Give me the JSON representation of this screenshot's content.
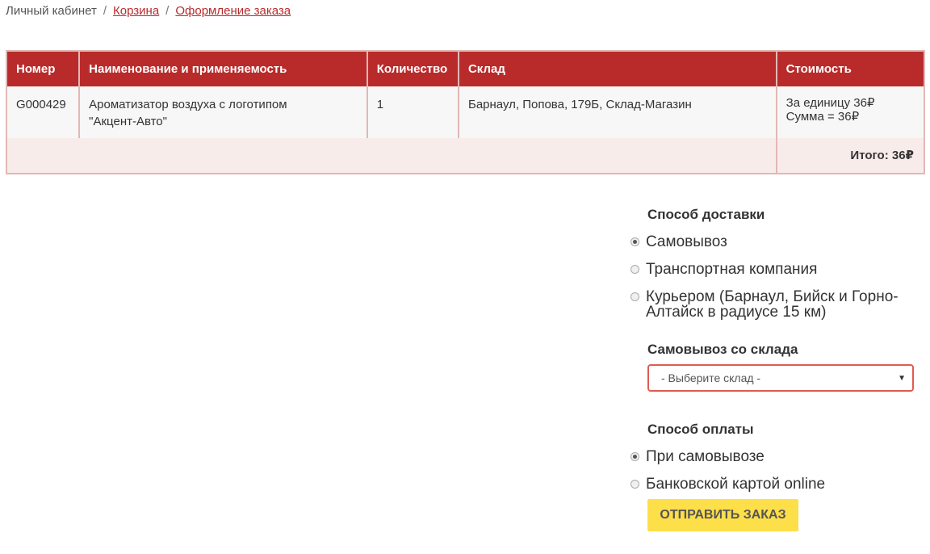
{
  "breadcrumb": {
    "items": [
      "Личный кабинет",
      "Корзина",
      "Оформление заказа"
    ],
    "separator": "/"
  },
  "table": {
    "headers": [
      "Номер",
      "Наименование и применяемость",
      "Количество",
      "Склад",
      "Стоимость"
    ],
    "rows": [
      {
        "number": "G000429",
        "name_line1": "Ароматизатор воздуха с логотипом",
        "name_line2": "\"Акцент-Авто\"",
        "quantity": "1",
        "warehouse": "Барнаул, Попова, 179Б, Склад-Магазин",
        "unit_price": "За единицу 36₽",
        "sum": "Сумма = 36₽"
      }
    ],
    "total": "Итого: 36₽"
  },
  "delivery": {
    "title": "Способ доставки",
    "options": [
      "Самовывоз",
      "Транспортная компания",
      "Курьером (Барнаул, Бийск и Горно-Алтайск в радиусе 15 км)"
    ],
    "selected_index": 0
  },
  "pickup": {
    "title": "Самовывоз со склада",
    "select_value": "- Выберите склад -"
  },
  "payment": {
    "title": "Способ оплаты",
    "options": [
      "При самовывозе",
      "Банковской картой online"
    ],
    "selected_index": 0
  },
  "submit": {
    "label": "ОТПРАВИТЬ ЗАКАЗ"
  },
  "colors": {
    "accent": "#b92b2b",
    "border": "#e1b8b5",
    "button": "#fddf4a",
    "select_border": "#e05b52"
  }
}
